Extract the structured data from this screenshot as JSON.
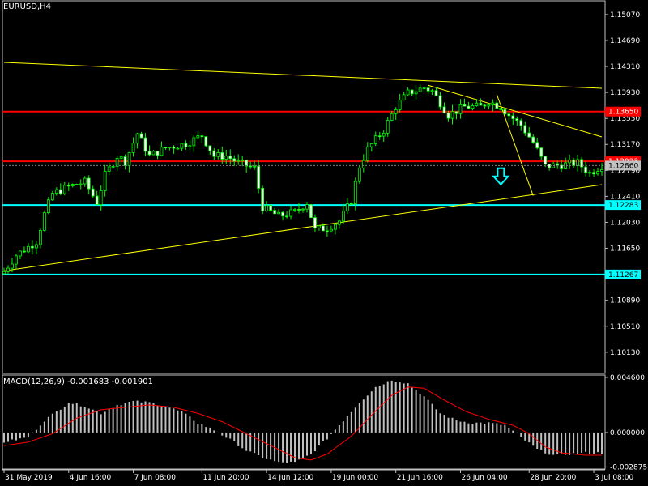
{
  "symbol_label": "EURUSD,H4",
  "macd_label": "MACD(12,26,9) -0.001683 -0.001901",
  "colors": {
    "background": "#000000",
    "candle": "#00ff00",
    "grid": "#c0c0c0",
    "trendline": "#ffff00",
    "resistance": "#ff0000",
    "support": "#00ffff",
    "histogram": "#c0c0c0",
    "signal": "#ff0000",
    "price_tag": "#c0c0c0",
    "arrow": "#00ffff"
  },
  "chart_data": [
    {
      "type": "candlestick",
      "symbol": "EURUSD",
      "timeframe": "H4",
      "y_ticks": [
        1.1507,
        1.1469,
        1.1431,
        1.1393,
        1.1355,
        1.1317,
        1.1279,
        1.1241,
        1.1203,
        1.1165,
        1.1127,
        1.1089,
        1.1051,
        1.1013
      ],
      "y_tick_labels": [
        "1.15070",
        "1.14690",
        "1.14310",
        "1.13930",
        "1.13550",
        "1.13170",
        "1.12790",
        "1.12410",
        "1.12030",
        "1.11650",
        "1.11270",
        "1.10890",
        "1.10510",
        "1.10130"
      ],
      "ylim": [
        1.0982,
        1.1527
      ],
      "x_labels": [
        "31 May 2019",
        "4 Jun 16:00",
        "7 Jun 08:00",
        "11 Jun 20:00",
        "14 Jun 12:00",
        "19 Jun 00:00",
        "21 Jun 16:00",
        "26 Jun 04:00",
        "28 Jun 20:00",
        "3 Jul 08:00"
      ],
      "bars_count": 149,
      "price_path": [
        [
          0,
          1.1131
        ],
        [
          3,
          1.1155
        ],
        [
          8,
          1.1175
        ],
        [
          10,
          1.1215
        ],
        [
          12,
          1.1245
        ],
        [
          16,
          1.1255
        ],
        [
          20,
          1.1262
        ],
        [
          23,
          1.1232
        ],
        [
          25,
          1.1272
        ],
        [
          28,
          1.13
        ],
        [
          30,
          1.1292
        ],
        [
          33,
          1.1333
        ],
        [
          36,
          1.13
        ],
        [
          40,
          1.1312
        ],
        [
          45,
          1.1318
        ],
        [
          49,
          1.133
        ],
        [
          52,
          1.13
        ],
        [
          55,
          1.13
        ],
        [
          58,
          1.129
        ],
        [
          62,
          1.1282
        ],
        [
          64,
          1.1225
        ],
        [
          68,
          1.1212
        ],
        [
          72,
          1.1218
        ],
        [
          75,
          1.1232
        ],
        [
          77,
          1.1192
        ],
        [
          80,
          1.1195
        ],
        [
          83,
          1.1205
        ],
        [
          86,
          1.1235
        ],
        [
          88,
          1.1285
        ],
        [
          90,
          1.131
        ],
        [
          94,
          1.1338
        ],
        [
          97,
          1.1372
        ],
        [
          100,
          1.1392
        ],
        [
          104,
          1.14
        ],
        [
          106,
          1.1395
        ],
        [
          108,
          1.1378
        ],
        [
          110,
          1.136
        ],
        [
          114,
          1.1372
        ],
        [
          118,
          1.1372
        ],
        [
          120,
          1.138
        ],
        [
          123,
          1.1372
        ],
        [
          125,
          1.136
        ],
        [
          128,
          1.1345
        ],
        [
          131,
          1.132
        ],
        [
          134,
          1.1285
        ],
        [
          138,
          1.1287
        ],
        [
          142,
          1.129
        ],
        [
          145,
          1.1275
        ],
        [
          148,
          1.1286
        ]
      ],
      "horizontal_levels": [
        {
          "price": 1.1365,
          "label": "1.13650",
          "kind": "resistance"
        },
        {
          "price": 1.12923,
          "label": "1.12923",
          "kind": "resistance"
        },
        {
          "price": 1.12283,
          "label": "1.12283",
          "kind": "support"
        },
        {
          "price": 1.11267,
          "label": "1.11267",
          "kind": "support"
        }
      ],
      "current_price": {
        "price": 1.1286,
        "label": "1.12860"
      },
      "trendlines": [
        {
          "x1": 0,
          "y1": 1.1437,
          "x2": 148,
          "y2": 1.1399
        },
        {
          "x1": 105,
          "y1": 1.14035,
          "x2": 148,
          "y2": 1.1328
        },
        {
          "x1": 122,
          "y1": 1.139,
          "x2": 131,
          "y2": 1.1242
        },
        {
          "x1": 0,
          "y1": 1.1132,
          "x2": 148,
          "y2": 1.1258
        }
      ],
      "signal_arrow": {
        "bar": 123,
        "price": 1.1282,
        "direction": "down"
      }
    },
    {
      "type": "histogram+line",
      "title": "MACD(12,26,9)",
      "main_value": -0.001683,
      "signal_value": -0.001901,
      "y_ticks": [
        0.0046,
        0.0,
        -0.002875
      ],
      "y_tick_labels": [
        "0.004600",
        "0.000000",
        "-0.002875"
      ],
      "ylim": [
        -0.00305,
        0.0048
      ],
      "histogram_path": [
        [
          0,
          -0.0008
        ],
        [
          6,
          -0.0004
        ],
        [
          10,
          0.001
        ],
        [
          16,
          0.0025
        ],
        [
          20,
          0.0022
        ],
        [
          24,
          0.0016
        ],
        [
          28,
          0.0023
        ],
        [
          32,
          0.0026
        ],
        [
          36,
          0.0025
        ],
        [
          40,
          0.0022
        ],
        [
          44,
          0.0017
        ],
        [
          48,
          0.0008
        ],
        [
          52,
          0.0002
        ],
        [
          56,
          -0.0006
        ],
        [
          60,
          -0.0015
        ],
        [
          64,
          -0.0021
        ],
        [
          68,
          -0.0025
        ],
        [
          72,
          -0.0025
        ],
        [
          76,
          -0.0018
        ],
        [
          80,
          -0.0005
        ],
        [
          84,
          0.001
        ],
        [
          88,
          0.0025
        ],
        [
          92,
          0.0038
        ],
        [
          96,
          0.0044
        ],
        [
          100,
          0.0041
        ],
        [
          104,
          0.003
        ],
        [
          108,
          0.0016
        ],
        [
          112,
          0.001
        ],
        [
          116,
          0.0008
        ],
        [
          120,
          0.0008
        ],
        [
          124,
          0.0006
        ],
        [
          128,
          -0.0004
        ],
        [
          132,
          -0.0014
        ],
        [
          136,
          -0.0019
        ],
        [
          140,
          -0.0018
        ],
        [
          144,
          -0.0017
        ],
        [
          148,
          -0.0017
        ]
      ],
      "signal_path": [
        [
          0,
          -0.0011
        ],
        [
          6,
          -0.0008
        ],
        [
          12,
          -0.0001
        ],
        [
          18,
          0.0012
        ],
        [
          24,
          0.0019
        ],
        [
          30,
          0.0021
        ],
        [
          36,
          0.0023
        ],
        [
          42,
          0.0021
        ],
        [
          48,
          0.0016
        ],
        [
          54,
          0.0009
        ],
        [
          60,
          -0.0001
        ],
        [
          66,
          -0.0011
        ],
        [
          72,
          -0.0021
        ],
        [
          76,
          -0.0023
        ],
        [
          80,
          -0.0018
        ],
        [
          86,
          -0.0003
        ],
        [
          92,
          0.0018
        ],
        [
          96,
          0.0031
        ],
        [
          100,
          0.0038
        ],
        [
          104,
          0.0037
        ],
        [
          108,
          0.0029
        ],
        [
          114,
          0.0018
        ],
        [
          120,
          0.0011
        ],
        [
          126,
          0.0006
        ],
        [
          130,
          -0.0001
        ],
        [
          134,
          -0.0012
        ],
        [
          138,
          -0.0017
        ],
        [
          144,
          -0.0019
        ],
        [
          148,
          -0.0019
        ]
      ]
    }
  ]
}
